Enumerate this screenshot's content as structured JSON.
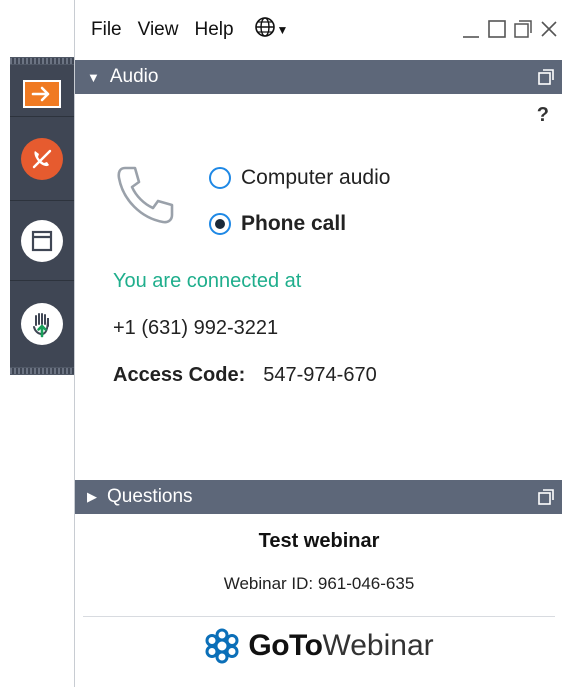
{
  "menu": {
    "file": "File",
    "view": "View",
    "help": "Help",
    "language_icon": "globe-icon"
  },
  "window_controls": [
    "minimize-icon",
    "restore-icon",
    "close-icon"
  ],
  "audio": {
    "title": "Audio",
    "help": "?",
    "options": [
      {
        "label": "Computer audio",
        "selected": false
      },
      {
        "label": "Phone call",
        "selected": true
      }
    ],
    "connected_text": "You are connected at",
    "phone_number": "+1 (631) 992-3221",
    "access_code_label": "Access Code:",
    "access_code": "547-974-670"
  },
  "questions": {
    "title": "Questions",
    "webinar_title": "Test webinar",
    "webinar_id": "Webinar ID: 961-046-635"
  },
  "brand": {
    "goto": "GoTo",
    "webinar": "Webinar"
  },
  "dock": {
    "buttons": [
      "collapse-arrow-icon",
      "mute-phone-icon",
      "window-icon",
      "raise-hand-icon"
    ]
  },
  "colors": {
    "accent_orange": "#f07a22",
    "mute_red": "#e65b2f",
    "section_bar": "#5d6779",
    "connected_green": "#1fae8c",
    "radio_blue": "#1e88e5"
  }
}
